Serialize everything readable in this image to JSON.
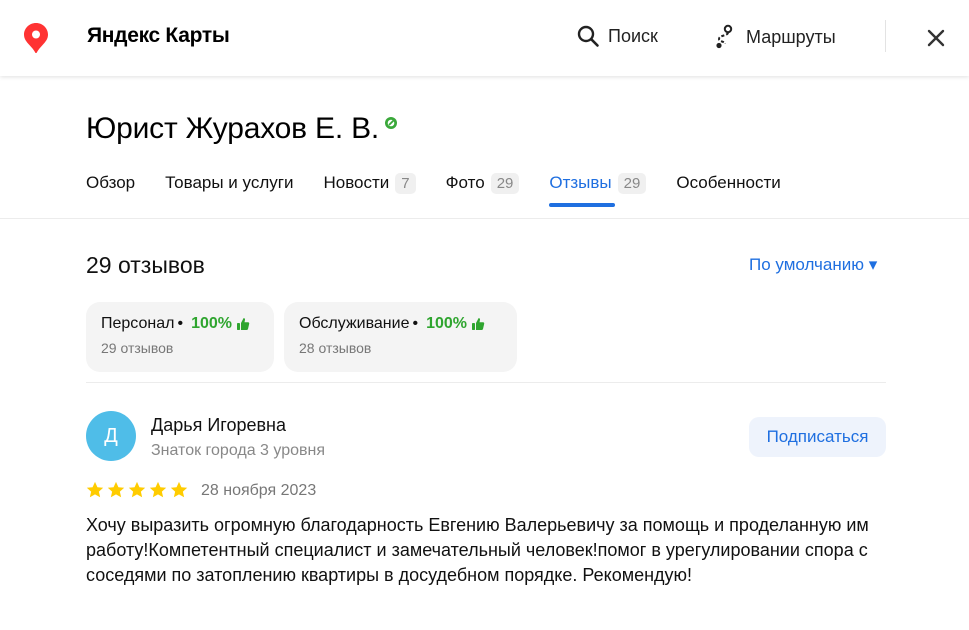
{
  "header": {
    "brand": "Яндекс Карты",
    "search_label": "Поиск",
    "routes_label": "Маршруты",
    "accent": "#f33"
  },
  "org": {
    "title": "Юрист Журахов Е. В.",
    "verified_color": "#3aa83a"
  },
  "tabs": [
    {
      "label": "Обзор",
      "count": ""
    },
    {
      "label": "Товары и услуги",
      "count": ""
    },
    {
      "label": "Новости",
      "count": "7"
    },
    {
      "label": "Фото",
      "count": "29"
    },
    {
      "label": "Отзывы",
      "count": "29",
      "active": true
    },
    {
      "label": "Особенности",
      "count": ""
    }
  ],
  "reviews": {
    "count_label": "29 отзывов",
    "sort_label": "По умолчанию ▾",
    "aspects": [
      {
        "name": "Персонал",
        "percent": "100%",
        "count": "29 отзывов"
      },
      {
        "name": "Обслуживание",
        "percent": "100%",
        "count": "28 отзывов"
      }
    ]
  },
  "review": {
    "avatar_letter": "Д",
    "author": "Дарья Игоревна",
    "level": "Знаток города 3 уровня",
    "subscribe_label": "Подписаться",
    "rating": 5,
    "date": "28 ноября 2023",
    "text": "Хочу выразить огромную благодарность Евгению Валерьевичу за помощь и проделанную им работу!Компетентный специалист и замечательный человек!помог в урегулировании спора с соседями по затоплению квартиры в досудебном порядке. Рекомендую!"
  },
  "colors": {
    "link": "#1f6fe0",
    "positive": "#2fa52f",
    "star": "#fc0",
    "avatar": "#4fbde8"
  }
}
